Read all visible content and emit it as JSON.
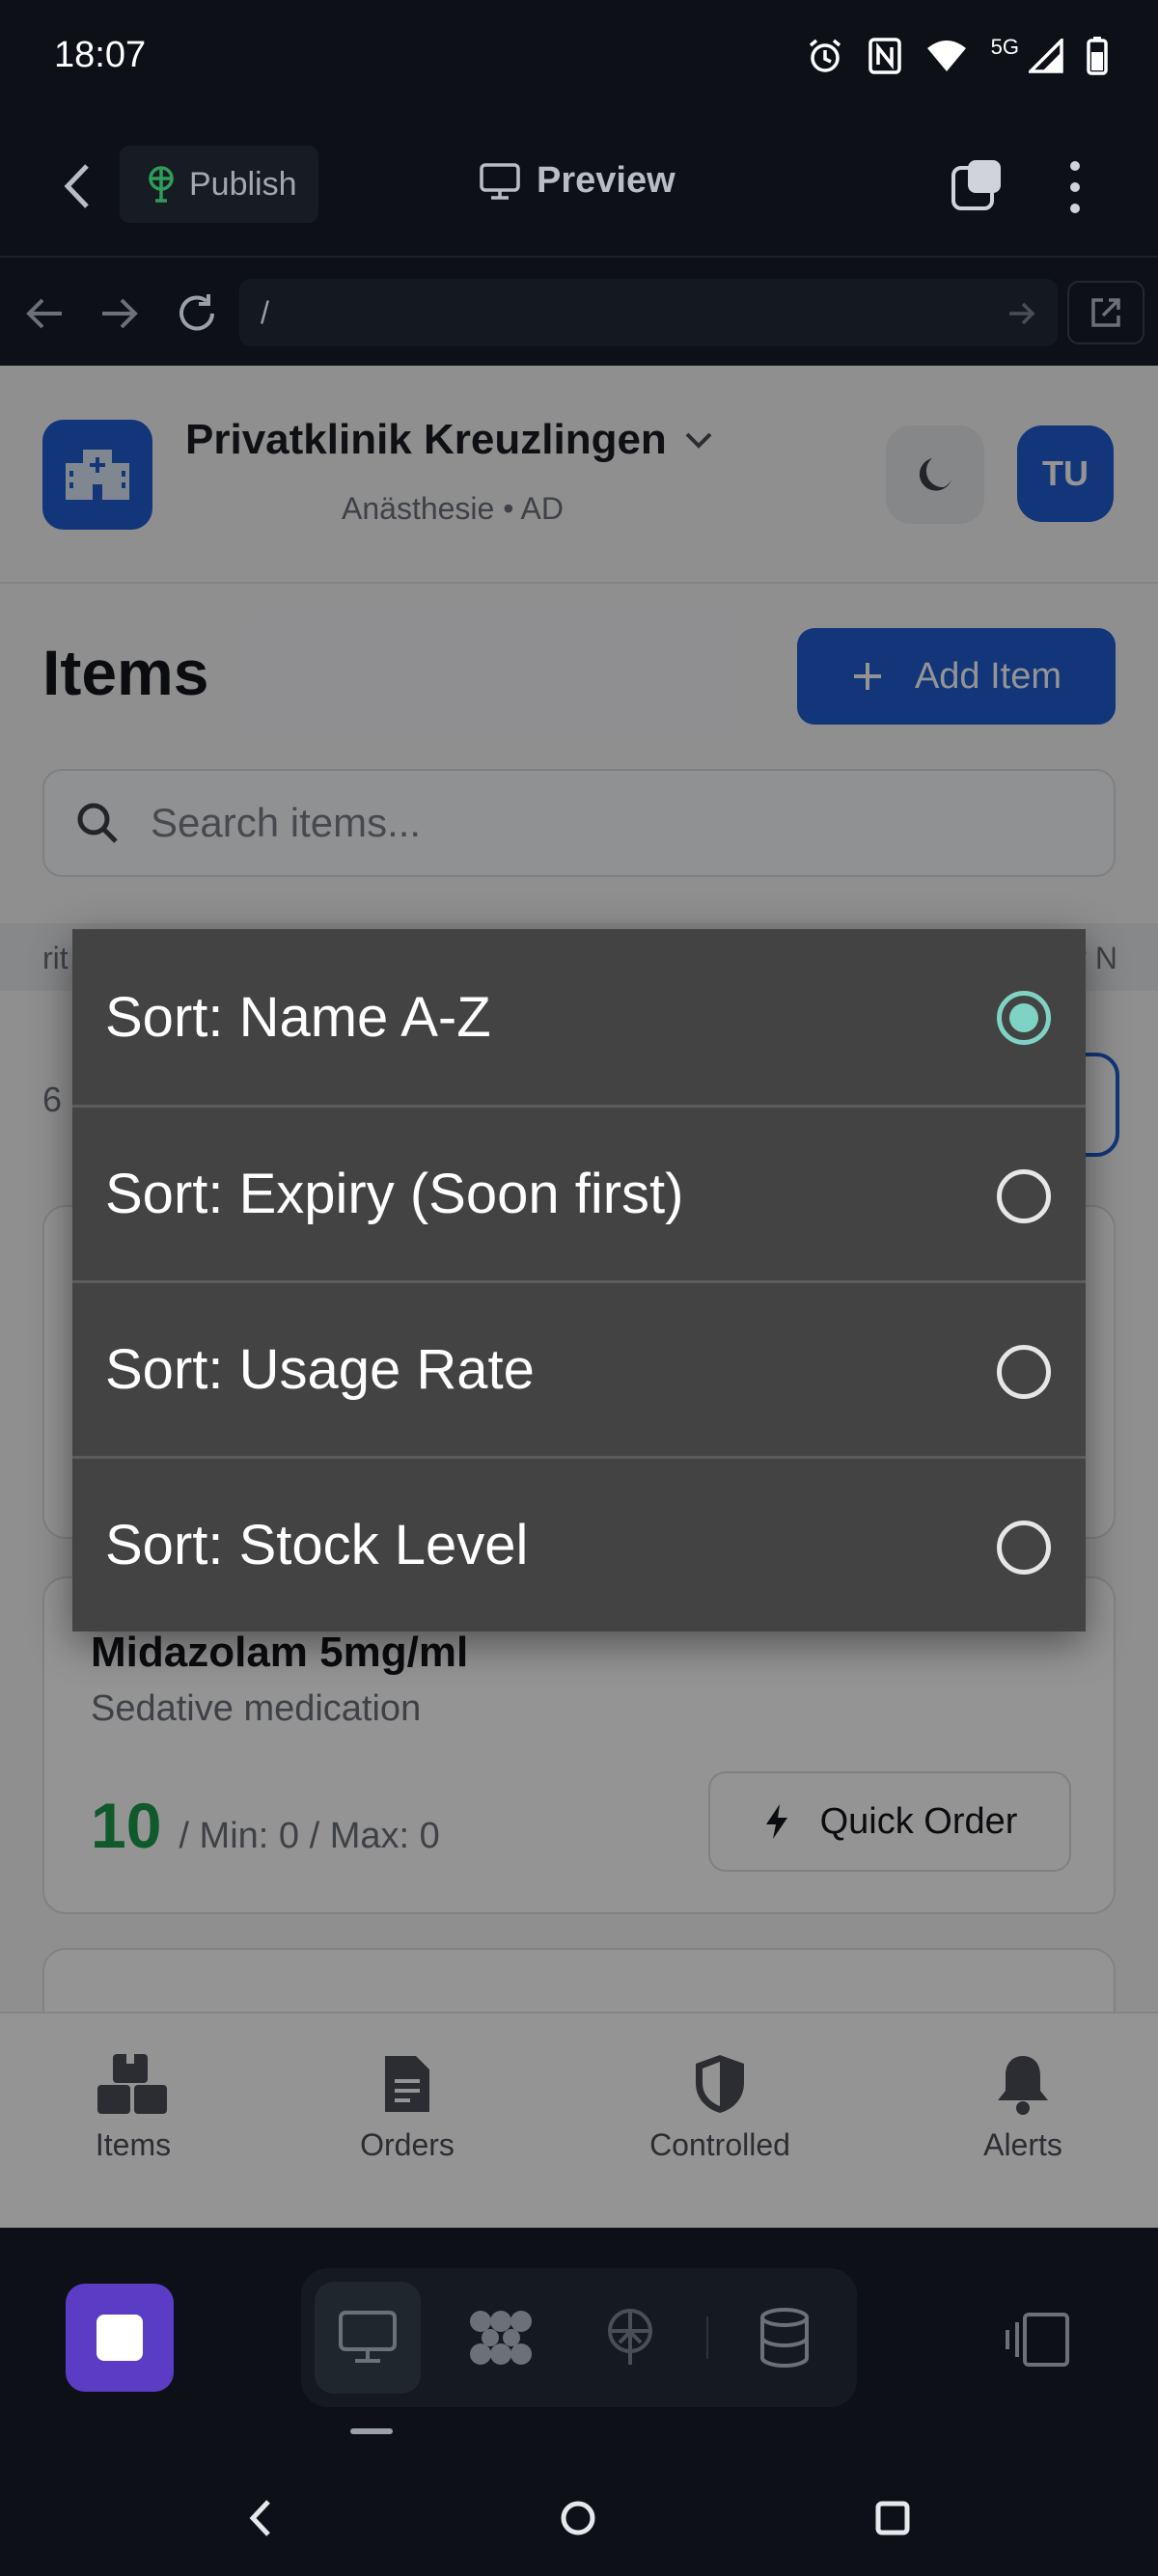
{
  "status_bar": {
    "time": "18:07",
    "network": "5G"
  },
  "editor_bar": {
    "publish_label": "Publish",
    "preview_label": "Preview"
  },
  "browser_bar": {
    "url": "/"
  },
  "header": {
    "clinic_name": "Privatklinik Kreuzlingen",
    "clinic_sub": "Anästhesie • AD",
    "avatar_initials": "TU"
  },
  "page": {
    "title": "Items",
    "add_item_label": "Add Item",
    "search_placeholder": "Search items...",
    "filter_left": "rit",
    "filter_right": "v N",
    "count_text": "6"
  },
  "items": [
    {
      "name": "",
      "description": ""
    },
    {
      "name": "Midazolam 5mg/ml",
      "description": "Sedative medication",
      "quantity": "10",
      "limits": "/ Min: 0 / Max: 0",
      "quick_order_label": "Quick Order"
    }
  ],
  "tab_bar": [
    {
      "label": "Items",
      "icon": "boxes-icon"
    },
    {
      "label": "Orders",
      "icon": "document-icon"
    },
    {
      "label": "Controlled",
      "icon": "shield-icon"
    },
    {
      "label": "Alerts",
      "icon": "bell-icon"
    }
  ],
  "sort_dialog": {
    "options": [
      {
        "label": "Sort: Name A-Z",
        "selected": true
      },
      {
        "label": "Sort: Expiry (Soon first)",
        "selected": false
      },
      {
        "label": "Sort: Usage Rate",
        "selected": false
      },
      {
        "label": "Sort: Stock Level",
        "selected": false
      }
    ]
  },
  "colors": {
    "primary": "#1f5ed0",
    "stock_ok": "#1a9a4a",
    "radio_selected": "#7fd3c4",
    "dialog_bg": "#434343",
    "editor_accent": "#5b3cc4"
  }
}
